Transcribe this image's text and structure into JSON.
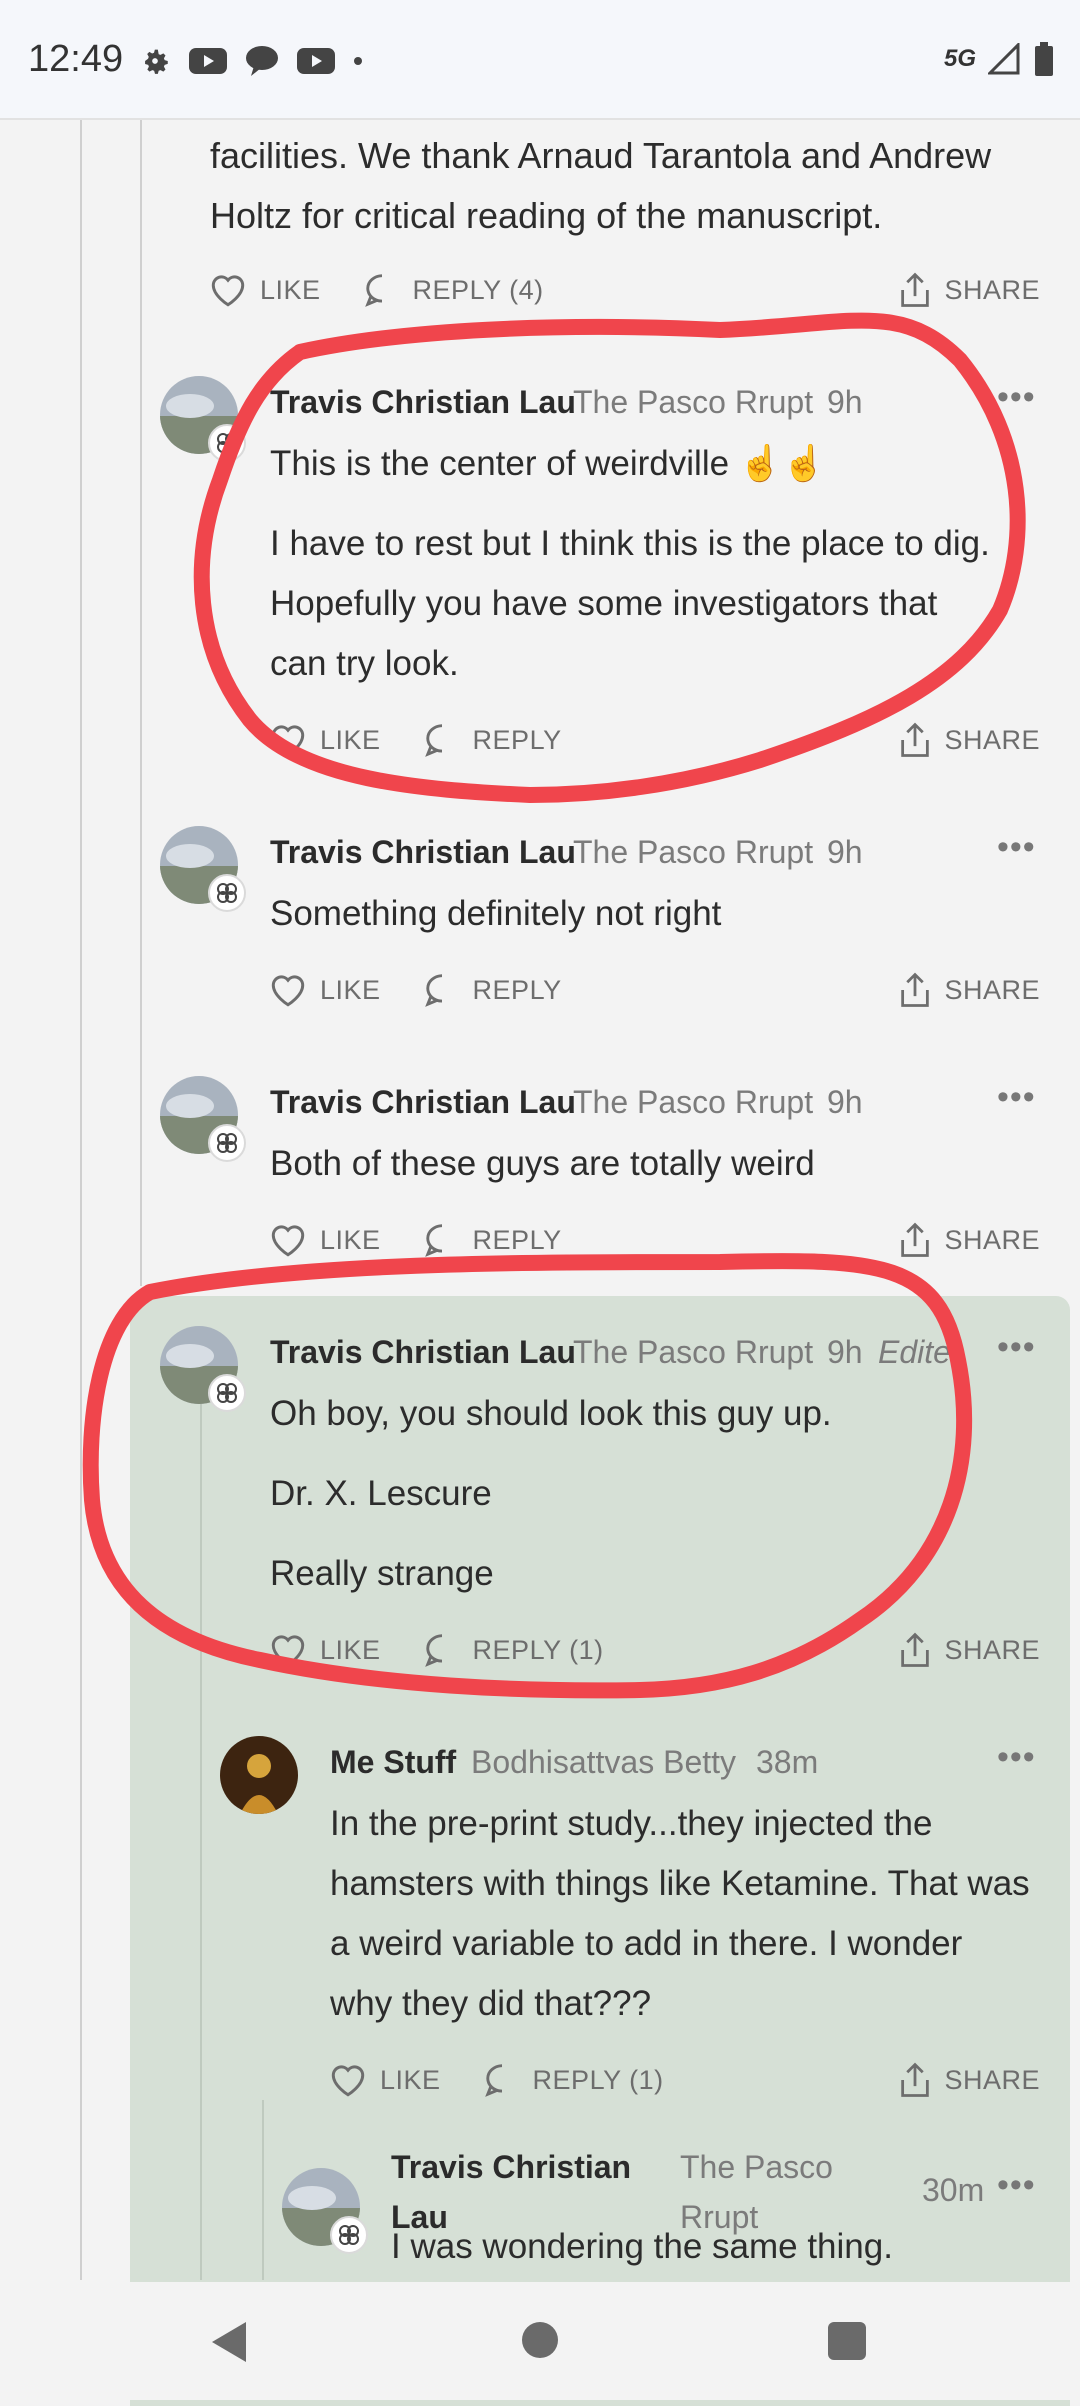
{
  "status_bar": {
    "time": "12:49",
    "network": "5G",
    "icons": [
      "gear-icon",
      "youtube-icon",
      "chat-icon",
      "youtube-icon",
      "dot-icon"
    ]
  },
  "top_excerpt": {
    "lines": [
      "facilities. We thank Arnaud Tarantola and Andrew",
      "Holtz for critical reading of the manuscript."
    ],
    "actions": {
      "like": "LIKE",
      "reply": "REPLY (4)",
      "share": "SHARE"
    }
  },
  "comments": [
    {
      "author": "Travis Christian Lau",
      "community": "The Pasco Rrupt",
      "age": "9h",
      "paragraphs": [
        "This is the center of weirdville ☝️☝️",
        "I have to rest but I think this is the place to dig. Hopefully you have some investigators that can try look."
      ],
      "actions": {
        "like": "LIKE",
        "reply": "REPLY",
        "share": "SHARE"
      }
    },
    {
      "author": "Travis Christian Lau",
      "community": "The Pasco Rrupt",
      "age": "9h",
      "paragraphs": [
        "Something definitely not right"
      ],
      "actions": {
        "like": "LIKE",
        "reply": "REPLY",
        "share": "SHARE"
      }
    },
    {
      "author": "Travis Christian Lau",
      "community": "The Pasco Rrupt",
      "age": "9h",
      "paragraphs": [
        "Both of these guys are totally weird"
      ],
      "actions": {
        "like": "LIKE",
        "reply": "REPLY",
        "share": "SHARE"
      }
    },
    {
      "author": "Travis Christian Lau",
      "community": "The Pasco Rrupt",
      "age": "9h",
      "edited": "Edite",
      "paragraphs": [
        "Oh boy, you should look this guy up.",
        "Dr. X. Lescure",
        "Really strange"
      ],
      "actions": {
        "like": "LIKE",
        "reply": "REPLY (1)",
        "share": "SHARE"
      }
    },
    {
      "author": "Me Stuff",
      "community": "Bodhisattvas Betty",
      "age": "38m",
      "paragraphs": [
        "In the pre-print study...they injected the hamsters with things like Ketamine. That was a weird variable to add in there. I wonder why they did that???"
      ],
      "actions": {
        "like": "LIKE",
        "reply": "REPLY (1)",
        "share": "SHARE"
      }
    },
    {
      "author": "Travis Christian Lau",
      "community": "The Pasco Rrupt",
      "age": "30m",
      "paragraphs": [
        "I was wondering the same thing."
      ]
    }
  ],
  "colors": {
    "annotation": "#f0454c",
    "highlight": "#d6e0d6"
  }
}
